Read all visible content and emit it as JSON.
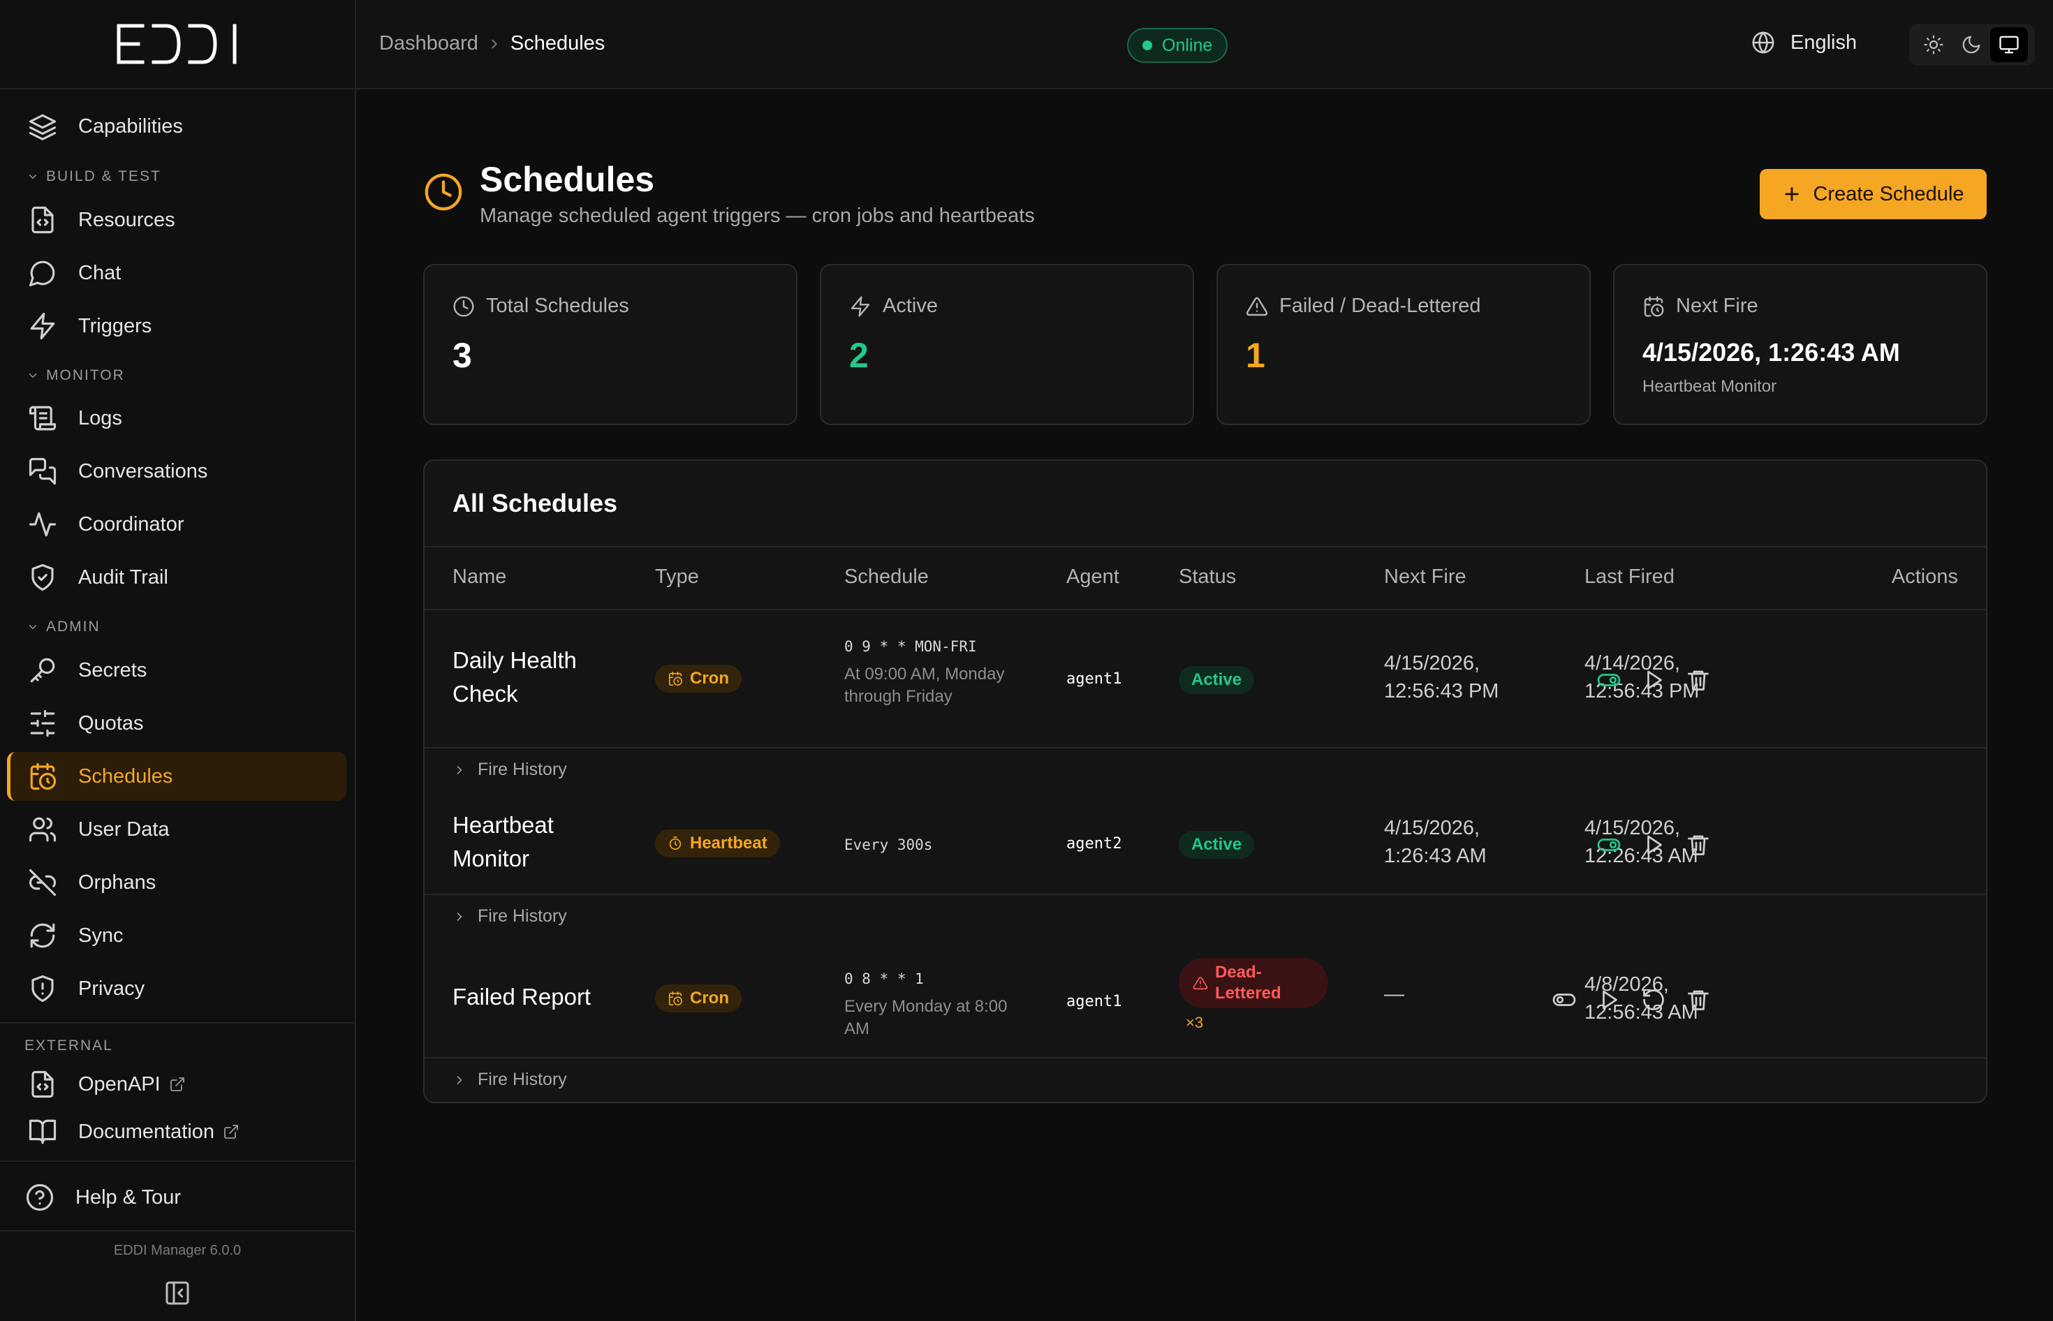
{
  "app": {
    "logo_text": "EDDI",
    "version": "EDDI Manager 6.0.0"
  },
  "sidebar": {
    "top_item": {
      "label": "Capabilities",
      "icon": "layers-icon"
    },
    "sections": {
      "build": "BUILD & TEST",
      "monitor": "MONITOR",
      "admin": "ADMIN",
      "external": "EXTERNAL"
    },
    "build_items": [
      {
        "label": "Resources",
        "icon": "file-code-icon"
      },
      {
        "label": "Chat",
        "icon": "chat-bubble-icon"
      },
      {
        "label": "Triggers",
        "icon": "lightning-icon"
      }
    ],
    "monitor_items": [
      {
        "label": "Logs",
        "icon": "scroll-icon"
      },
      {
        "label": "Conversations",
        "icon": "messages-icon"
      },
      {
        "label": "Coordinator",
        "icon": "activity-icon"
      },
      {
        "label": "Audit Trail",
        "icon": "shield-check-icon"
      }
    ],
    "admin_items": [
      {
        "label": "Secrets",
        "icon": "key-icon"
      },
      {
        "label": "Quotas",
        "icon": "sliders-icon"
      },
      {
        "label": "Schedules",
        "icon": "calendar-clock-icon",
        "active": true
      },
      {
        "label": "User Data",
        "icon": "users-icon"
      },
      {
        "label": "Orphans",
        "icon": "unlink-icon"
      },
      {
        "label": "Sync",
        "icon": "refresh-icon"
      },
      {
        "label": "Privacy",
        "icon": "shield-alert-icon"
      }
    ],
    "external_items": [
      {
        "label": "OpenAPI",
        "icon": "file-code-icon"
      },
      {
        "label": "Documentation",
        "icon": "book-icon"
      }
    ],
    "help": {
      "label": "Help & Tour",
      "icon": "help-circle-icon"
    }
  },
  "topbar": {
    "breadcrumb": [
      "Dashboard",
      "Schedules"
    ],
    "status": "Online",
    "language": "English",
    "theme_options": [
      "light",
      "dark",
      "system"
    ],
    "theme_selected": "system"
  },
  "page": {
    "title": "Schedules",
    "subtitle": "Manage scheduled agent triggers — cron jobs and heartbeats",
    "create_button": "Create Schedule"
  },
  "stats": {
    "total": {
      "label": "Total Schedules",
      "value": "3"
    },
    "active": {
      "label": "Active",
      "value": "2"
    },
    "failed": {
      "label": "Failed / Dead-Lettered",
      "value": "1"
    },
    "next_fire": {
      "label": "Next Fire",
      "value": "4/15/2026, 1:26:43 AM",
      "sub": "Heartbeat Monitor"
    }
  },
  "table": {
    "title": "All Schedules",
    "columns": [
      "Name",
      "Type",
      "Schedule",
      "Agent",
      "Status",
      "Next Fire",
      "Last Fired",
      "Actions"
    ],
    "fire_history_label": "Fire History",
    "rows": [
      {
        "name": "Daily Health Check",
        "type": "Cron",
        "schedule_expr": "0 9 * * MON-FRI",
        "schedule_desc": "At 09:00 AM, Monday through Friday",
        "agent": "agent1",
        "status": "Active",
        "next_fire": "4/15/2026, 12:56:43 PM",
        "last_fired": "4/14/2026, 12:56:43 PM"
      },
      {
        "name": "Heartbeat Monitor",
        "type": "Heartbeat",
        "schedule_expr": "Every 300s",
        "schedule_desc": "",
        "agent": "agent2",
        "status": "Active",
        "next_fire": "4/15/2026, 1:26:43 AM",
        "last_fired": "4/15/2026, 12:26:43 AM"
      },
      {
        "name": "Failed Report",
        "type": "Cron",
        "schedule_expr": "0 8 * * 1",
        "schedule_desc": "Every Monday at 8:00 AM",
        "agent": "agent1",
        "status": "Dead-Lettered",
        "fail_count": "×3",
        "next_fire": "—",
        "last_fired": "4/8/2026, 12:56:43 AM"
      }
    ]
  },
  "colors": {
    "accent": "#f5a623",
    "success": "#22c98a",
    "danger": "#ff5a5a",
    "background": "#0d0d0d"
  }
}
